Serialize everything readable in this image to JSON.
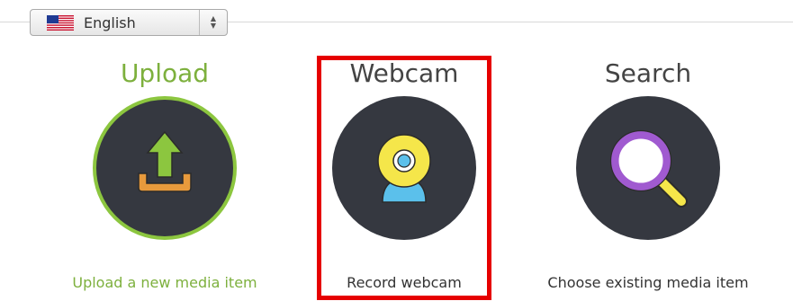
{
  "language_select": {
    "label": "English",
    "flag": "us-flag-icon"
  },
  "options": {
    "upload": {
      "title": "Upload",
      "description": "Upload a new media item",
      "icon": "upload-icon"
    },
    "webcam": {
      "title": "Webcam",
      "description": "Record webcam",
      "icon": "webcam-icon"
    },
    "search": {
      "title": "Search",
      "description": "Choose existing media item",
      "icon": "magnifier-icon"
    }
  },
  "colors": {
    "accent_green": "#7db03d",
    "circle_dark": "#353840",
    "highlight_red": "#e60000"
  }
}
